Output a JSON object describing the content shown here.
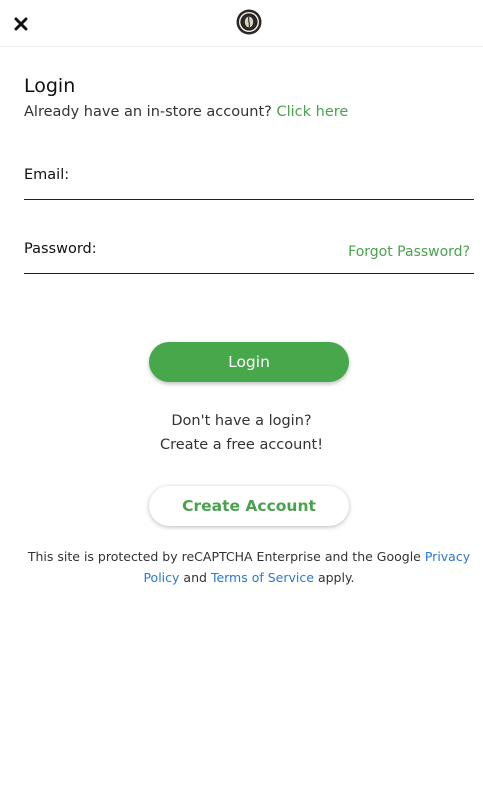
{
  "header": {
    "close_icon": "close-icon",
    "logo_icon": "brand-logo"
  },
  "login": {
    "title": "Login",
    "instore_text": "Already have an in-store account?",
    "instore_link": "Click here"
  },
  "form": {
    "email_label": "Email:",
    "email_value": "",
    "password_label": "Password:",
    "password_value": "",
    "forgot_password": "Forgot Password?"
  },
  "actions": {
    "login_button": "Login",
    "no_login_line1": "Don't have a login?",
    "no_login_line2": "Create a free account!",
    "create_account_button": "Create Account"
  },
  "recaptcha": {
    "text_before": "This site is protected by reCAPTCHA Enterprise and the Google",
    "privacy_link": "Privacy Policy",
    "and_text": "and",
    "terms_link": "Terms of Service",
    "text_after": "apply."
  },
  "colors": {
    "accent_green": "#47a84b",
    "link_green": "#4aa14f",
    "link_blue": "#2b78d4"
  }
}
